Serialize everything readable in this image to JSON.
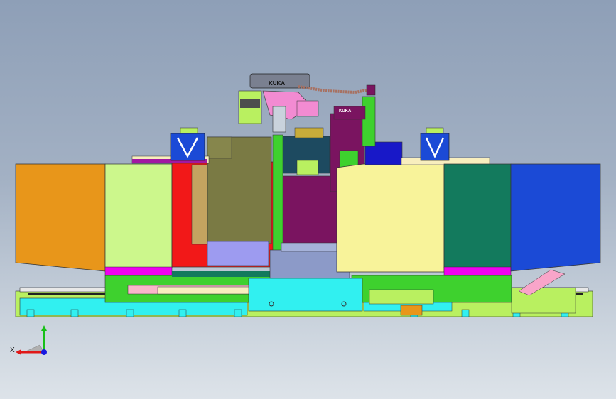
{
  "viewport": {
    "background_top": "#8e9fb7",
    "background_bottom": "#dde3e9"
  },
  "model": {
    "robot_brand_arm": "KUKA",
    "robot_brand_base": "KUKA",
    "colors": {
      "orange_guard": "#e8961a",
      "light_green_panel": "#ccf78c",
      "red_panel": "#f21818",
      "olive_block": "#7a7a44",
      "yellow_panel": "#f8f39a",
      "dark_green_panel": "#137a5d",
      "blue_panel": "#1b4ad6",
      "base_cyan": "#31f0f0",
      "magenta": "#f000f0",
      "purple": "#7a1460",
      "lavender": "#9d9bf0"
    }
  },
  "triad": {
    "x_label": "X",
    "x_color": "#e01818",
    "y_color": "#18c018",
    "z_color": "#1818e0"
  }
}
